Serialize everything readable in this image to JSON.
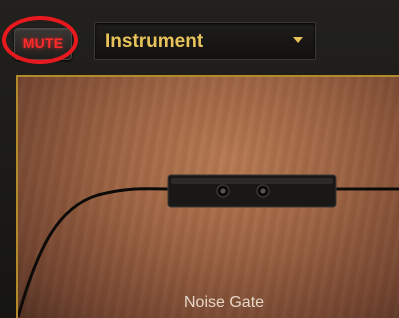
{
  "header": {
    "mute_label": "MUTE",
    "select_value": "Instrument"
  },
  "panel": {
    "pedal_label": "Noise Gate"
  },
  "colors": {
    "mute_text": "#ff2a2a",
    "select_text": "#e8c35a",
    "panel_border": "#b28a2a",
    "annotation_ring": "#e8191e"
  }
}
